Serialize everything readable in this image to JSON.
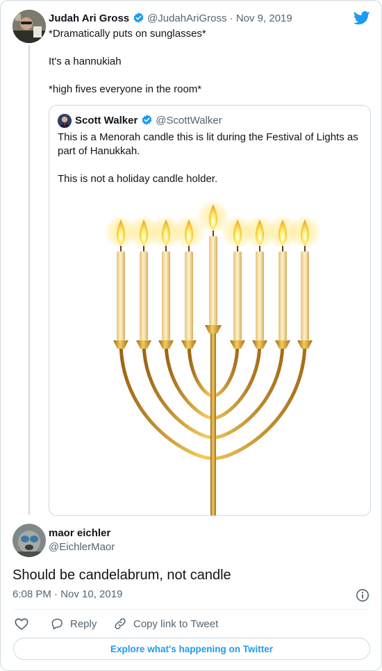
{
  "colors": {
    "twitter_blue": "#1d9bf0",
    "text_primary": "#0f1419",
    "text_secondary": "#536471",
    "border": "#cfd9de",
    "menorah_gold": "#d39a2a"
  },
  "parent_tweet": {
    "author_name": "Judah Ari Gross",
    "author_handle": "@JudahAriGross",
    "date_separator": " · ",
    "date": "Nov 9, 2019",
    "lines": [
      "*Dramatically puts on sunglasses*",
      "It's a hannukiah",
      "*high fives everyone in the room*"
    ],
    "icons": {
      "brand": "twitter-bird-icon",
      "verified": "verified-badge-icon"
    }
  },
  "quoted_tweet": {
    "author_name": "Scott Walker",
    "author_handle": "@ScottWalker",
    "text_line1": "This is a Menorah candle this is lit during the Festival of Lights as",
    "text_line2": "part of Hanukkah.",
    "text_line3": "This is not a holiday candle holder.",
    "image_icon": "menorah-illustration"
  },
  "reply_tweet": {
    "author_name": "maor eichler",
    "author_handle": "@EichlerMaor",
    "text": "Should be candelabrum, not candle",
    "timestamp": "6:08 PM · Nov 10, 2019",
    "info_icon": "info-icon"
  },
  "actions": {
    "like_icon": "heart-icon",
    "reply_label": "Reply",
    "reply_icon": "reply-bubble-icon",
    "copy_label": "Copy link to Tweet",
    "copy_icon": "link-icon"
  },
  "explore_label": "Explore what's happening on Twitter"
}
